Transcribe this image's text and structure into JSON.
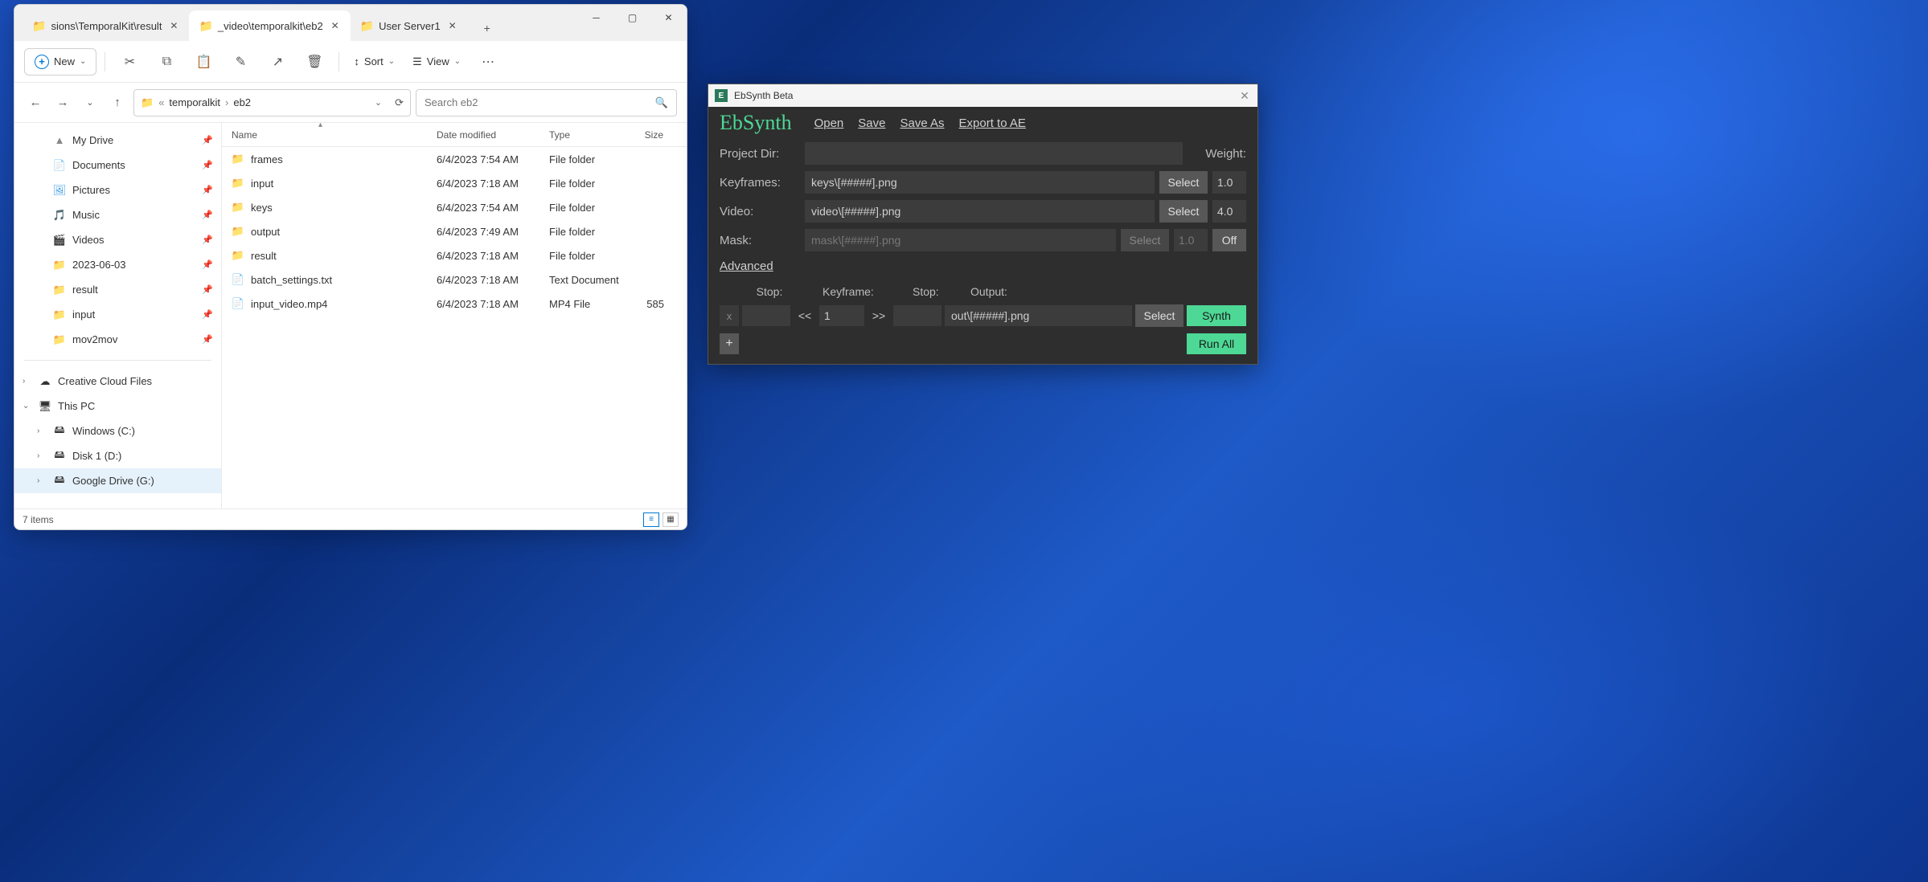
{
  "explorer": {
    "tabs": [
      {
        "label": "sions\\TemporalKit\\result"
      },
      {
        "label": "_video\\temporalkit\\eb2"
      },
      {
        "label": "User Server1"
      }
    ],
    "active_tab": 1,
    "toolbar": {
      "new": "New",
      "sort": "Sort",
      "view": "View"
    },
    "breadcrumb": {
      "prefix": "«",
      "a": "temporalkit",
      "b": "eb2"
    },
    "search_placeholder": "Search eb2",
    "columns": {
      "name": "Name",
      "date": "Date modified",
      "type": "Type",
      "size": "Size"
    },
    "side": {
      "quick": [
        {
          "name": "My Drive",
          "icon": "ic-gd"
        },
        {
          "name": "Documents",
          "icon": "ic-doc"
        },
        {
          "name": "Pictures",
          "icon": "ic-pic"
        },
        {
          "name": "Music",
          "icon": "ic-mus"
        },
        {
          "name": "Videos",
          "icon": "ic-vid"
        },
        {
          "name": "2023-06-03",
          "icon": "ic-folder"
        },
        {
          "name": "result",
          "icon": "ic-folder"
        },
        {
          "name": "input",
          "icon": "ic-folder"
        },
        {
          "name": "mov2mov",
          "icon": "ic-folder"
        }
      ],
      "nav": [
        {
          "name": "Creative Cloud Files",
          "level": 1,
          "chev": "›",
          "icon": "☁"
        },
        {
          "name": "This PC",
          "level": 1,
          "chev": "⌄",
          "icon": "🖥"
        },
        {
          "name": "Windows (C:)",
          "level": 2,
          "chev": "›",
          "icon": "🖴"
        },
        {
          "name": "Disk 1 (D:)",
          "level": 2,
          "chev": "›",
          "icon": "🖴"
        },
        {
          "name": "Google Drive (G:)",
          "level": 2,
          "chev": "›",
          "icon": "🖴",
          "sel": true
        }
      ]
    },
    "files": [
      {
        "name": "frames",
        "date": "6/4/2023 7:54 AM",
        "type": "File folder",
        "size": "",
        "icon": "folder"
      },
      {
        "name": "input",
        "date": "6/4/2023 7:18 AM",
        "type": "File folder",
        "size": "",
        "icon": "folder"
      },
      {
        "name": "keys",
        "date": "6/4/2023 7:54 AM",
        "type": "File folder",
        "size": "",
        "icon": "folder"
      },
      {
        "name": "output",
        "date": "6/4/2023 7:49 AM",
        "type": "File folder",
        "size": "",
        "icon": "folder"
      },
      {
        "name": "result",
        "date": "6/4/2023 7:18 AM",
        "type": "File folder",
        "size": "",
        "icon": "folder"
      },
      {
        "name": "batch_settings.txt",
        "date": "6/4/2023 7:18 AM",
        "type": "Text Document",
        "size": "",
        "icon": "file"
      },
      {
        "name": "input_video.mp4",
        "date": "6/4/2023 7:18 AM",
        "type": "MP4 File",
        "size": "585",
        "icon": "file"
      }
    ],
    "status": "7 items"
  },
  "ebsynth": {
    "title": "EbSynth Beta",
    "brand": "EbSynth",
    "menu": {
      "open": "Open",
      "save": "Save",
      "saveas": "Save As",
      "export": "Export to AE"
    },
    "labels": {
      "project": "Project Dir:",
      "keyframes": "Keyframes:",
      "video": "Video:",
      "mask": "Mask:",
      "weight": "Weight:",
      "advanced": "Advanced"
    },
    "fields": {
      "project": "",
      "keyframes": "keys\\[#####].png",
      "video": "video\\[#####].png",
      "mask": "mask\\[#####].png"
    },
    "weights": {
      "keyframes": "1.0",
      "video": "4.0",
      "mask": "1.0"
    },
    "buttons": {
      "select": "Select",
      "off": "Off",
      "synth": "Synth",
      "runall": "Run All",
      "plus": "+",
      "x": "x",
      "prev": "<<",
      "next": ">>"
    },
    "seq": {
      "hdr": {
        "stop1": "Stop:",
        "keyframe": "Keyframe:",
        "stop2": "Stop:",
        "output": "Output:"
      },
      "kf": "1",
      "out": "out\\[#####].png"
    }
  }
}
